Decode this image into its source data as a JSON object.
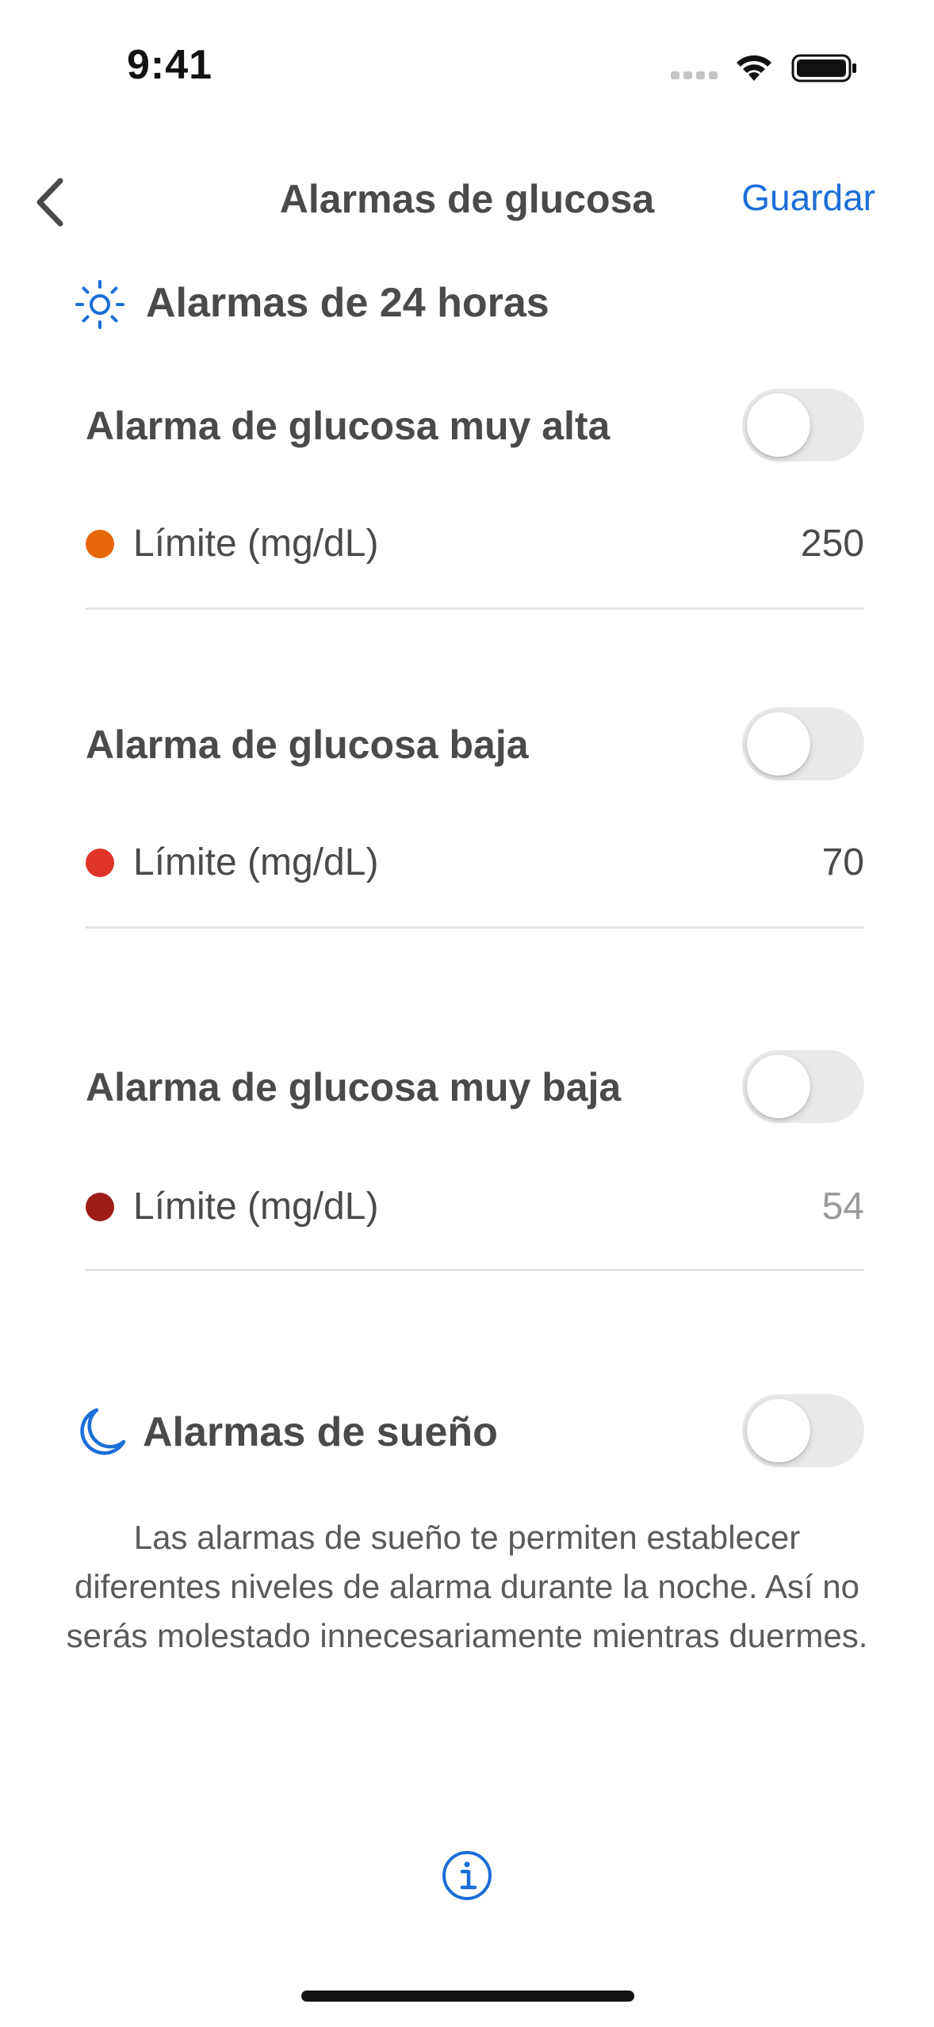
{
  "status_bar": {
    "time": "9:41"
  },
  "nav": {
    "title": "Alarmas de glucosa",
    "save_label": "Guardar"
  },
  "section_24h": {
    "title": "Alarmas de 24 horas",
    "icon": "sun-icon"
  },
  "alarms": [
    {
      "title": "Alarma de glucosa muy alta",
      "enabled": false,
      "limit_label": "Límite (mg/dL)",
      "limit_value": "250",
      "dot_color": "#e8670c"
    },
    {
      "title": "Alarma de glucosa baja",
      "enabled": false,
      "limit_label": "Límite (mg/dL)",
      "limit_value": "70",
      "dot_color": "#e13428"
    },
    {
      "title": "Alarma de glucosa muy baja",
      "enabled": false,
      "limit_label": "Límite (mg/dL)",
      "limit_value": "54",
      "dot_color": "#9e1c18"
    }
  ],
  "sleep": {
    "title": "Alarmas de sueño",
    "enabled": false,
    "icon": "moon-icon",
    "description": "Las alarmas de sueño te permiten establecer diferentes niveles de alarma durante la noche. Así no serás molestado innecesariamente mientras duermes."
  },
  "colors": {
    "accent": "#1a6ed8",
    "text": "#4a4a4c",
    "toggle_off": "#e9e9eb"
  }
}
